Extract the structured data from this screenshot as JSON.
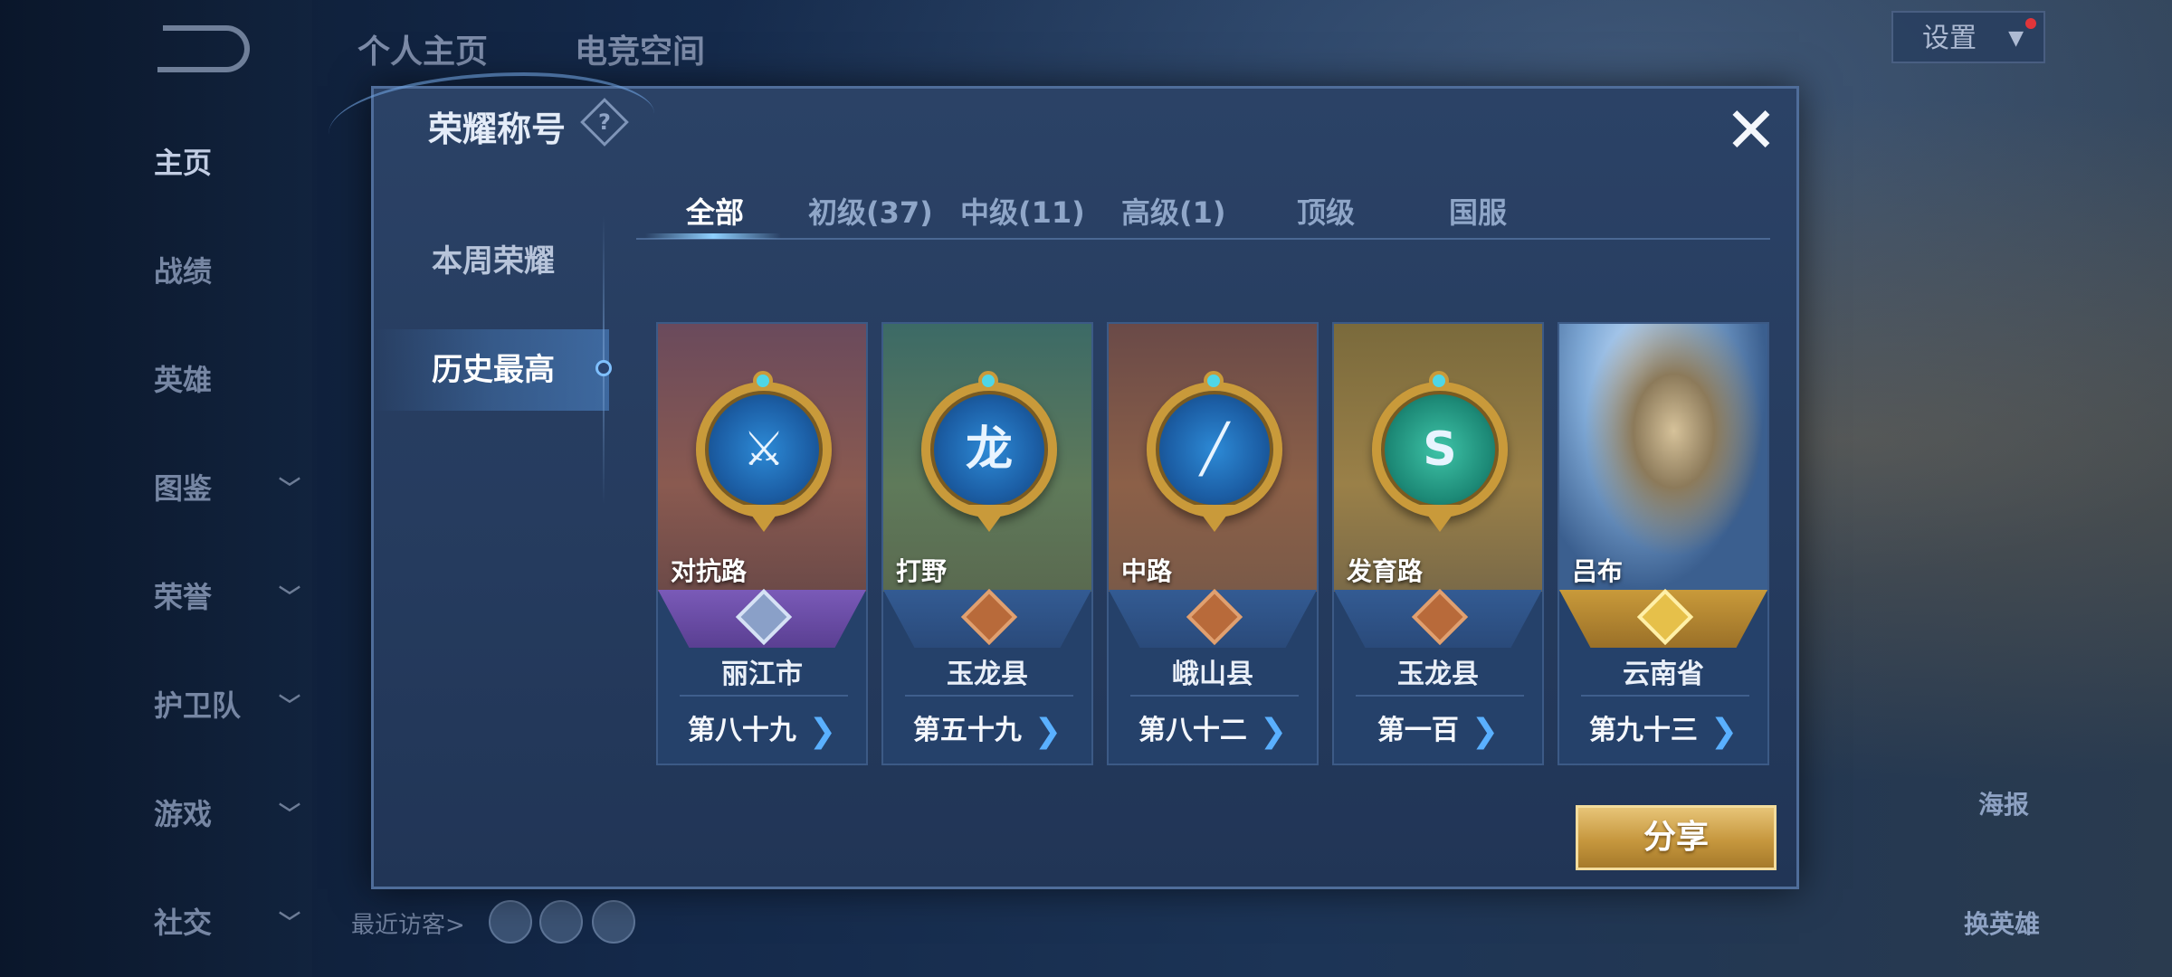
{
  "colors": {
    "accent_blue": "#5ab0ff",
    "gold": "#c99a3a",
    "modal_bg": "#2b4266",
    "share_button": "#c6973e"
  },
  "background": {
    "top_tabs": [
      "个人主页",
      "电竞空间"
    ],
    "settings_label": "设置",
    "left_nav": [
      {
        "label": "主页",
        "has_chevron": false,
        "active": true
      },
      {
        "label": "战绩",
        "has_chevron": false,
        "active": false
      },
      {
        "label": "英雄",
        "has_chevron": false,
        "active": false
      },
      {
        "label": "图鉴",
        "has_chevron": true,
        "active": false
      },
      {
        "label": "荣誉",
        "has_chevron": true,
        "active": false
      },
      {
        "label": "护卫队",
        "has_chevron": true,
        "active": false
      },
      {
        "label": "游戏",
        "has_chevron": true,
        "active": false
      },
      {
        "label": "社交",
        "has_chevron": true,
        "active": false
      }
    ],
    "recent_visitors_label": "最近访客>",
    "right_labels": [
      "海报",
      "换英雄"
    ]
  },
  "modal": {
    "title": "荣耀称号",
    "help_icon_glyph": "?",
    "close_glyph": "✕",
    "side_tabs": [
      {
        "label": "本周荣耀",
        "active": false
      },
      {
        "label": "历史最高",
        "active": true
      }
    ],
    "filter_tabs": [
      {
        "label": "全部",
        "active": true
      },
      {
        "label": "初级(37)",
        "active": false
      },
      {
        "label": "中级(11)",
        "active": false
      },
      {
        "label": "高级(1)",
        "active": false
      },
      {
        "label": "顶级",
        "active": false
      },
      {
        "label": "国服",
        "active": false
      }
    ],
    "cards": [
      {
        "role": "对抗路",
        "region": "丽江市",
        "rank": "第八十九",
        "badge_icon": "crossed-swords-icon",
        "badge_glyph": "⚔"
      },
      {
        "role": "打野",
        "region": "玉龙县",
        "rank": "第五十九",
        "badge_icon": "dragon-icon",
        "badge_glyph": "龙"
      },
      {
        "role": "中路",
        "region": "峨山县",
        "rank": "第八十二",
        "badge_icon": "wand-icon",
        "badge_glyph": "╱"
      },
      {
        "role": "发育路",
        "region": "玉龙县",
        "rank": "第一百",
        "badge_icon": "archer-icon",
        "badge_glyph": "S"
      },
      {
        "role": "吕布",
        "region": "云南省",
        "rank": "第九十三",
        "badge_icon": "hero-portrait-icon",
        "badge_glyph": ""
      }
    ],
    "rank_arrow": "❯",
    "share_label": "分享"
  }
}
